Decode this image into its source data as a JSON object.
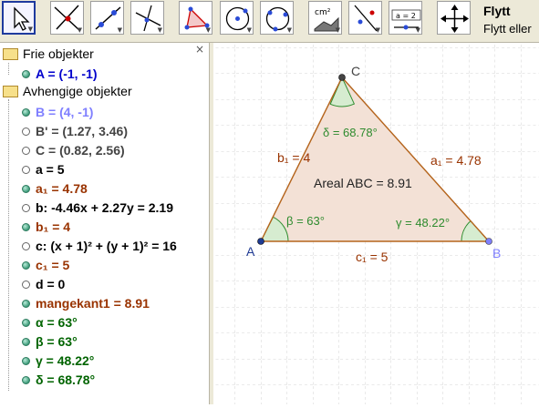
{
  "toolbar": {
    "mode_title": "Flytt",
    "mode_help": "Flytt eller",
    "buttons": [
      {
        "name": "move-tool-button",
        "icon": "cursor-arrow-icon"
      },
      {
        "name": "point-tool-button",
        "icon": "intersect-point-icon"
      },
      {
        "name": "line-tool-button",
        "icon": "line-through-points-icon"
      },
      {
        "name": "perpendicular-tool-button",
        "icon": "perpendicular-line-icon"
      },
      {
        "name": "polygon-tool-button",
        "icon": "polygon-icon"
      },
      {
        "name": "circle-tool-button",
        "icon": "circle-center-point-icon"
      },
      {
        "name": "circle-three-points-tool-button",
        "icon": "circle-three-points-icon"
      },
      {
        "name": "area-tool-button",
        "icon": "area-measure-icon",
        "label": "cm²"
      },
      {
        "name": "reflect-tool-button",
        "icon": "reflect-line-icon"
      },
      {
        "name": "slider-tool-button",
        "icon": "slider-icon",
        "label": "a = 2"
      },
      {
        "name": "move-view-tool-button",
        "icon": "move-graphics-view-icon"
      }
    ]
  },
  "algebra": {
    "close_label": "×",
    "free_header": "Frie objekter",
    "dependent_header": "Avhengige objekter",
    "free": [
      {
        "text": "A = (-1, -1)",
        "color": "#0000cc",
        "visible": true
      }
    ],
    "dependent": [
      {
        "text": "B = (4, -1)",
        "color": "#7f7fff",
        "visible": true
      },
      {
        "text": "B' = (1.27, 3.46)",
        "color": "#444444",
        "visible": false
      },
      {
        "text": "C = (0.82, 2.56)",
        "color": "#444444",
        "visible": false
      },
      {
        "text": "a = 5",
        "color": "#000000",
        "visible": false
      },
      {
        "text": "a₁ = 4.78",
        "color": "#993300",
        "visible": true
      },
      {
        "text": "b: -4.46x + 2.27y = 2.19",
        "color": "#000000",
        "visible": false
      },
      {
        "text": "b₁ = 4",
        "color": "#993300",
        "visible": true
      },
      {
        "text": "c: (x + 1)² + (y + 1)² = 16",
        "color": "#000000",
        "visible": false
      },
      {
        "text": "c₁ = 5",
        "color": "#993300",
        "visible": true
      },
      {
        "text": "d = 0",
        "color": "#000000",
        "visible": false
      },
      {
        "text": "mangekant1 = 8.91",
        "color": "#993300",
        "visible": true
      },
      {
        "text": "α = 63°",
        "color": "#006400",
        "visible": true
      },
      {
        "text": "β = 63°",
        "color": "#006400",
        "visible": true
      },
      {
        "text": "γ = 48.22°",
        "color": "#006400",
        "visible": true
      },
      {
        "text": "δ = 68.78°",
        "color": "#006400",
        "visible": true
      }
    ]
  },
  "graphics": {
    "point_A": "A",
    "point_B": "B",
    "point_C": "C",
    "label_a1": "a₁ = 4.78",
    "label_b1": "b₁ = 4",
    "label_c1": "c₁ = 5",
    "area_label": "Areal ABC = 8.91",
    "angle_beta": "β = 63°",
    "angle_gamma": "γ = 48.22°",
    "angle_delta": "δ = 68.78°",
    "colors": {
      "edge": "#b5651d",
      "fill": "#f3e1d6",
      "angle_green": "#2e8b2e",
      "edge_label": "#993300",
      "point_A": "#1f3a93",
      "point_B": "#7f7fff",
      "point_C": "#444444"
    }
  }
}
